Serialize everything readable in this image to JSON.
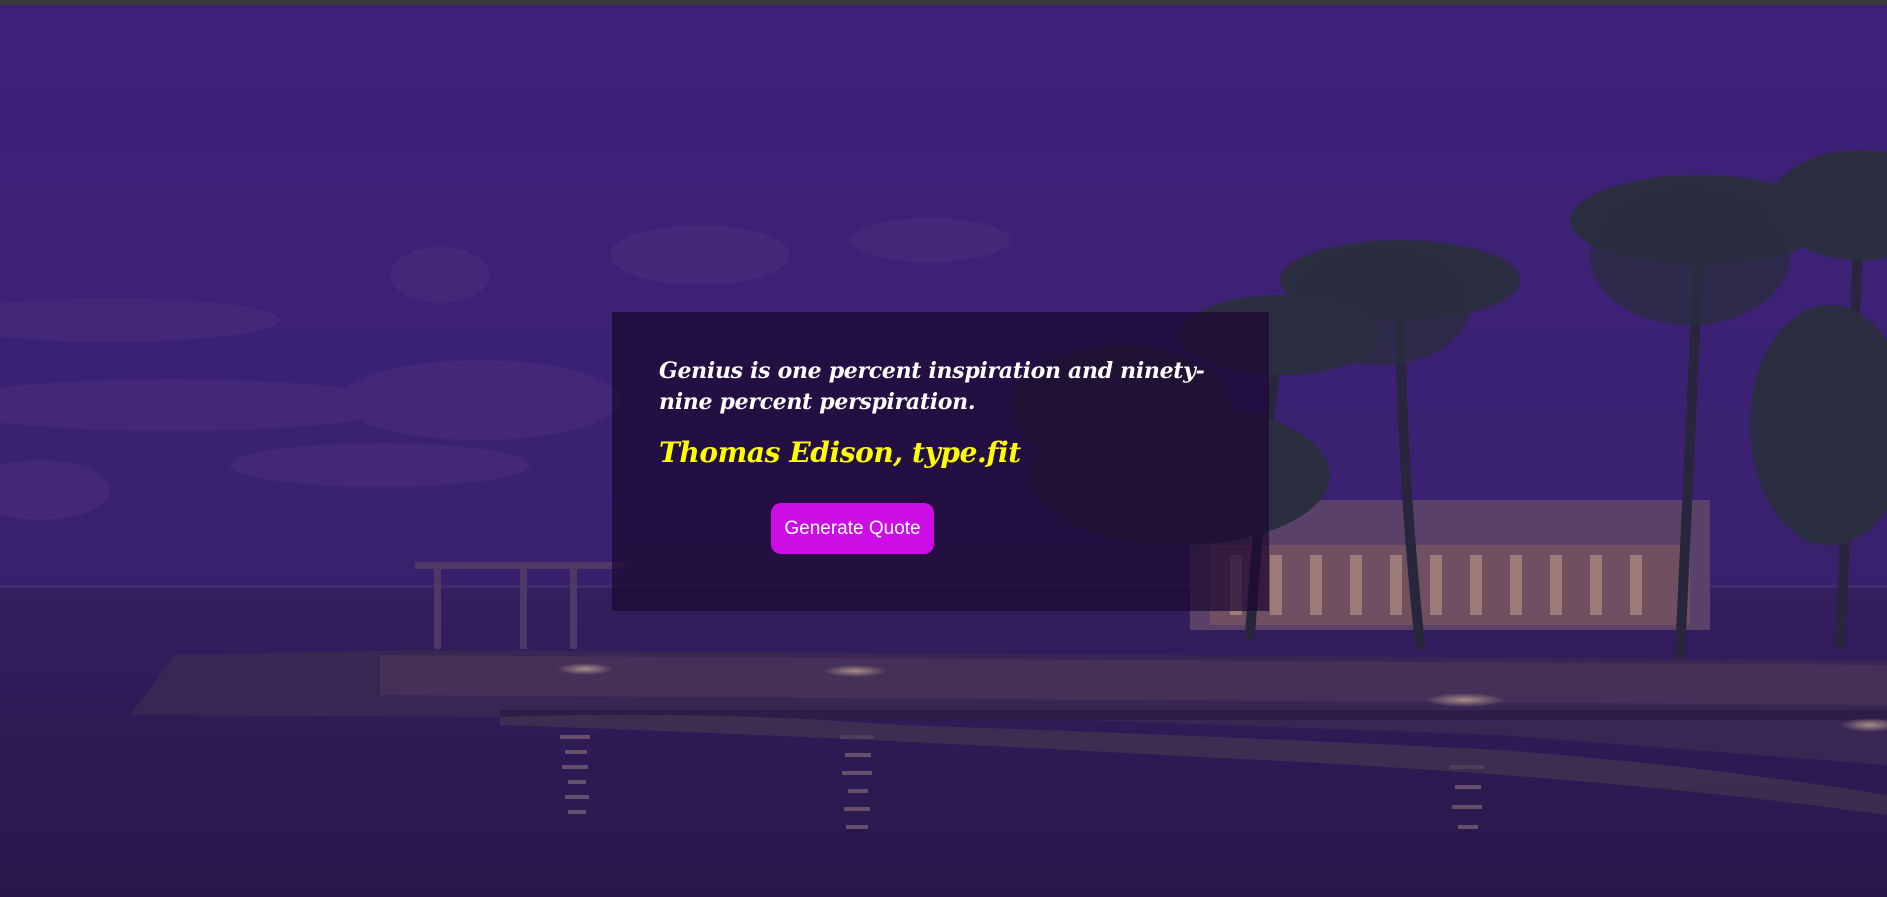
{
  "quote": {
    "text": "Genius is one percent inspiration and ninety-nine percent perspiration.",
    "author": "Thomas Edison, type.fit"
  },
  "generate_button": {
    "label": "Generate Quote"
  },
  "colors": {
    "overlay": "#3d2070",
    "card_background": "#1c0830",
    "quote_text": "#ffffff",
    "author_text": "#ffff00",
    "button_background": "#cc0de6",
    "button_text": "#ffffff"
  }
}
